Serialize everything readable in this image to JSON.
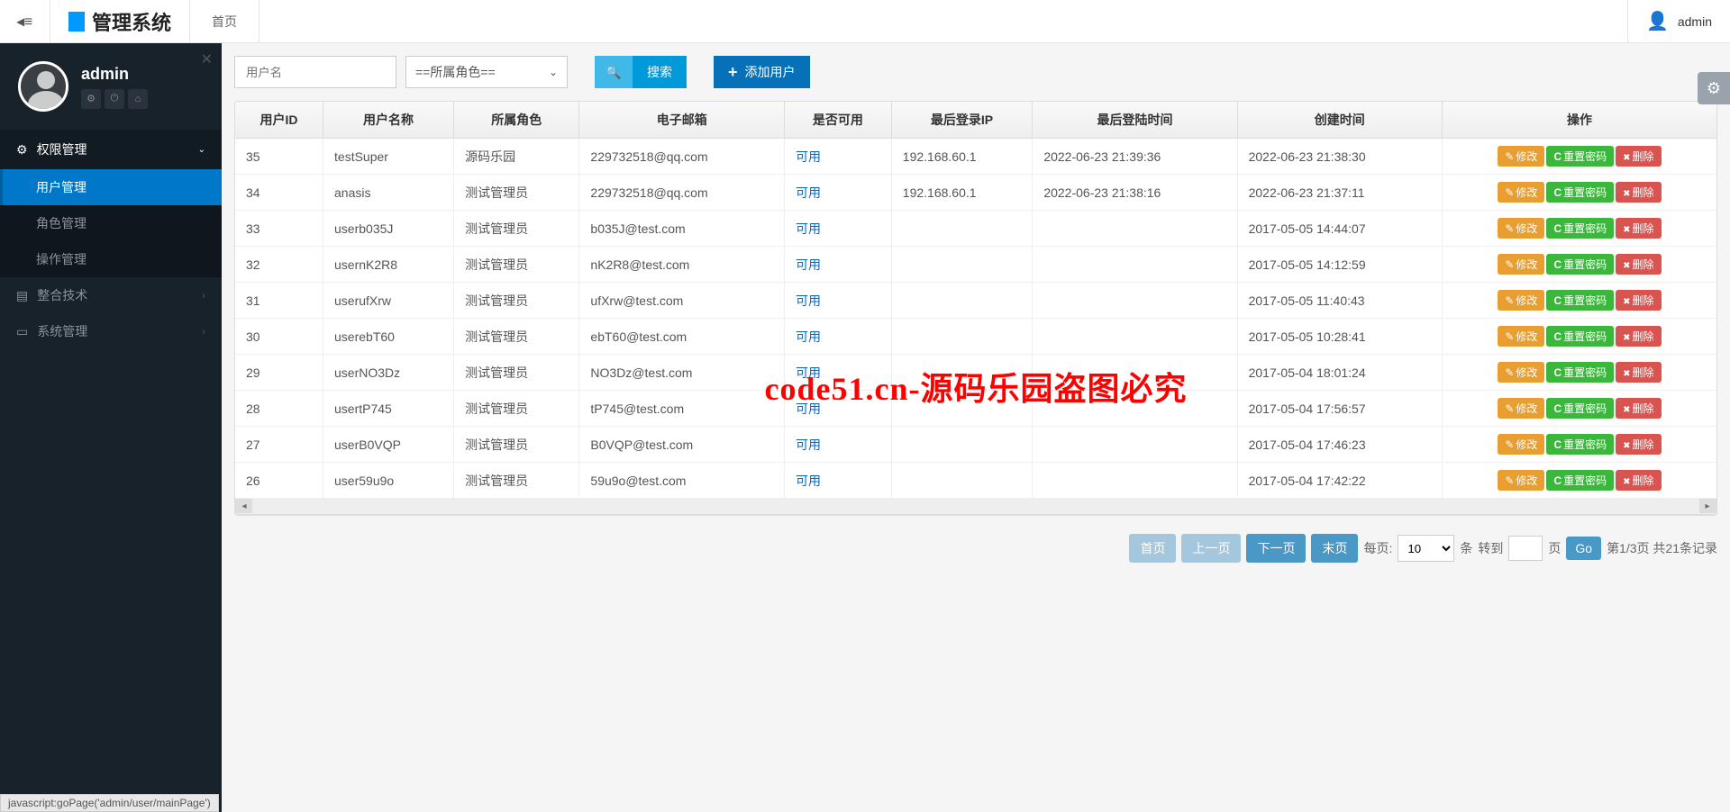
{
  "topbar": {
    "brand": "管理系统",
    "home": "首页",
    "username": "admin"
  },
  "sidebar": {
    "profile_name": "admin",
    "menus": [
      {
        "label": "权限管理",
        "expanded": true,
        "items": [
          "用户管理",
          "角色管理",
          "操作管理"
        ],
        "active_index": 0
      },
      {
        "label": "整合技术"
      },
      {
        "label": "系统管理"
      }
    ]
  },
  "toolbar": {
    "username_placeholder": "用户名",
    "role_selected": "==所属角色==",
    "search_label": "搜索",
    "add_user_label": "添加用户"
  },
  "table": {
    "headers": [
      "用户ID",
      "用户名称",
      "所属角色",
      "电子邮箱",
      "是否可用",
      "最后登录IP",
      "最后登陆时间",
      "创建时间",
      "操作"
    ],
    "actions": {
      "edit": "修改",
      "reset": "重置密码",
      "delete": "删除"
    },
    "rows": [
      {
        "id": "35",
        "name": "testSuper",
        "role": "源码乐园",
        "email": "229732518@qq.com",
        "status": "可用",
        "ip": "192.168.60.1",
        "last_login": "2022-06-23 21:39:36",
        "created": "2022-06-23 21:38:30"
      },
      {
        "id": "34",
        "name": "anasis",
        "role": "测试管理员",
        "email": "229732518@qq.com",
        "status": "可用",
        "ip": "192.168.60.1",
        "last_login": "2022-06-23 21:38:16",
        "created": "2022-06-23 21:37:11"
      },
      {
        "id": "33",
        "name": "userb035J",
        "role": "测试管理员",
        "email": "b035J@test.com",
        "status": "可用",
        "ip": "",
        "last_login": "",
        "created": "2017-05-05 14:44:07"
      },
      {
        "id": "32",
        "name": "usernK2R8",
        "role": "测试管理员",
        "email": "nK2R8@test.com",
        "status": "可用",
        "ip": "",
        "last_login": "",
        "created": "2017-05-05 14:12:59"
      },
      {
        "id": "31",
        "name": "userufXrw",
        "role": "测试管理员",
        "email": "ufXrw@test.com",
        "status": "可用",
        "ip": "",
        "last_login": "",
        "created": "2017-05-05 11:40:43"
      },
      {
        "id": "30",
        "name": "userebT60",
        "role": "测试管理员",
        "email": "ebT60@test.com",
        "status": "可用",
        "ip": "",
        "last_login": "",
        "created": "2017-05-05 10:28:41"
      },
      {
        "id": "29",
        "name": "userNO3Dz",
        "role": "测试管理员",
        "email": "NO3Dz@test.com",
        "status": "可用",
        "ip": "",
        "last_login": "",
        "created": "2017-05-04 18:01:24"
      },
      {
        "id": "28",
        "name": "usertP745",
        "role": "测试管理员",
        "email": "tP745@test.com",
        "status": "可用",
        "ip": "",
        "last_login": "",
        "created": "2017-05-04 17:56:57"
      },
      {
        "id": "27",
        "name": "userB0VQP",
        "role": "测试管理员",
        "email": "B0VQP@test.com",
        "status": "可用",
        "ip": "",
        "last_login": "",
        "created": "2017-05-04 17:46:23"
      },
      {
        "id": "26",
        "name": "user59u9o",
        "role": "测试管理员",
        "email": "59u9o@test.com",
        "status": "可用",
        "ip": "",
        "last_login": "",
        "created": "2017-05-04 17:42:22"
      }
    ]
  },
  "pagination": {
    "first": "首页",
    "prev": "上一页",
    "next": "下一页",
    "last": "末页",
    "per_page_label": "每页:",
    "per_page_value": "10",
    "unit": "条",
    "goto": "转到",
    "page_unit": "页",
    "go": "Go",
    "summary": "第1/3页 共21条记录"
  },
  "statusbar": "javascript:goPage('admin/user/mainPage')",
  "watermark": "code51.cn-源码乐园盗图必究"
}
